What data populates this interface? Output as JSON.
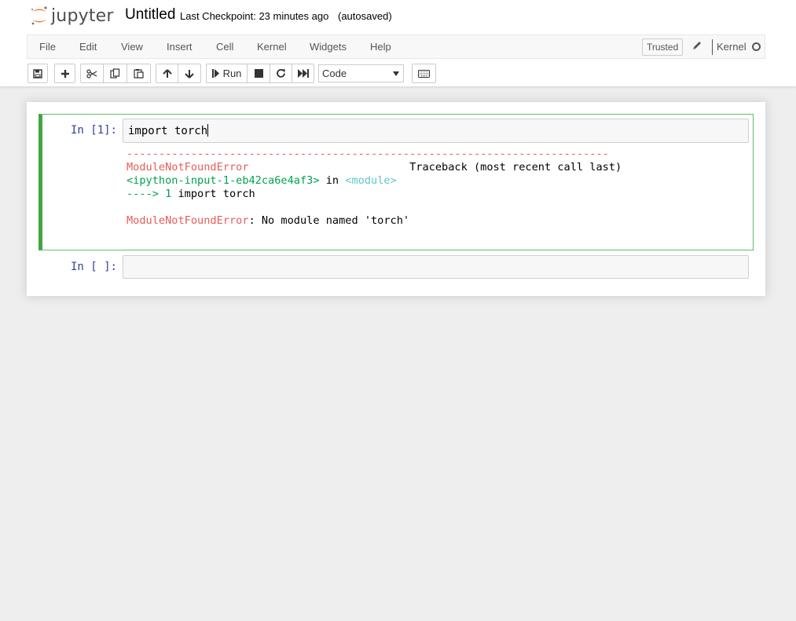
{
  "header": {
    "logo_text": "jupyter",
    "notebook_name": "Untitled",
    "checkpoint": "Last Checkpoint: 23 minutes ago",
    "autosave": "(autosaved)"
  },
  "menubar": {
    "items": [
      "File",
      "Edit",
      "View",
      "Insert",
      "Cell",
      "Kernel",
      "Widgets",
      "Help"
    ],
    "trusted": "Trusted",
    "kernel_name": "Kernel"
  },
  "toolbar": {
    "run_label": "Run",
    "cell_type": "Code"
  },
  "cells": [
    {
      "prompt": "In [1]:",
      "source": "import torch",
      "output": {
        "separator": "---------------------------------------------------------------------------",
        "error_name": "ModuleNotFoundError",
        "traceback_label": "Traceback (most recent call last)",
        "input_ref": "<ipython-input-1-eb42ca6e4af3>",
        "in_word": " in ",
        "module_ref": "<module>",
        "arrow": "----> 1 ",
        "arrow_code": "import torch",
        "error_message": ": No module named 'torch'"
      }
    },
    {
      "prompt": "In [ ]:",
      "source": ""
    }
  ],
  "colors": {
    "selected_cell_border": "#42a542",
    "prompt": "#303f9f",
    "error_red": "#e75c58",
    "ansi_green": "#00a250",
    "ansi_cyan": "#60c6c8"
  }
}
